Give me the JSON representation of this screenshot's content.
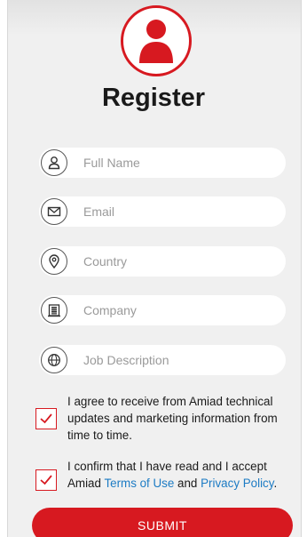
{
  "header": {
    "title": "Register"
  },
  "form": {
    "fields": [
      {
        "placeholder": "Full Name",
        "value": ""
      },
      {
        "placeholder": "Email",
        "value": ""
      },
      {
        "placeholder": "Country",
        "value": ""
      },
      {
        "placeholder": "Company",
        "value": ""
      },
      {
        "placeholder": "Job Description",
        "value": ""
      }
    ],
    "consent_marketing": {
      "checked": true,
      "text": "I agree to receive from Amiad technical updates and marketing information from time to time."
    },
    "consent_terms": {
      "checked": true,
      "text_before": "I confirm that I have read and I accept Amiad ",
      "terms_link": "Terms of Use",
      "text_and": " and ",
      "privacy_link": "Privacy Policy",
      "text_end": "."
    },
    "submit_label": "SUBMIT"
  },
  "colors": {
    "accent": "#d71920",
    "link": "#1c7bc4",
    "background": "#f0f0f0"
  },
  "icons": [
    "user-icon",
    "envelope-icon",
    "location-pin-icon",
    "building-icon",
    "globe-icon",
    "checkmark-icon"
  ]
}
